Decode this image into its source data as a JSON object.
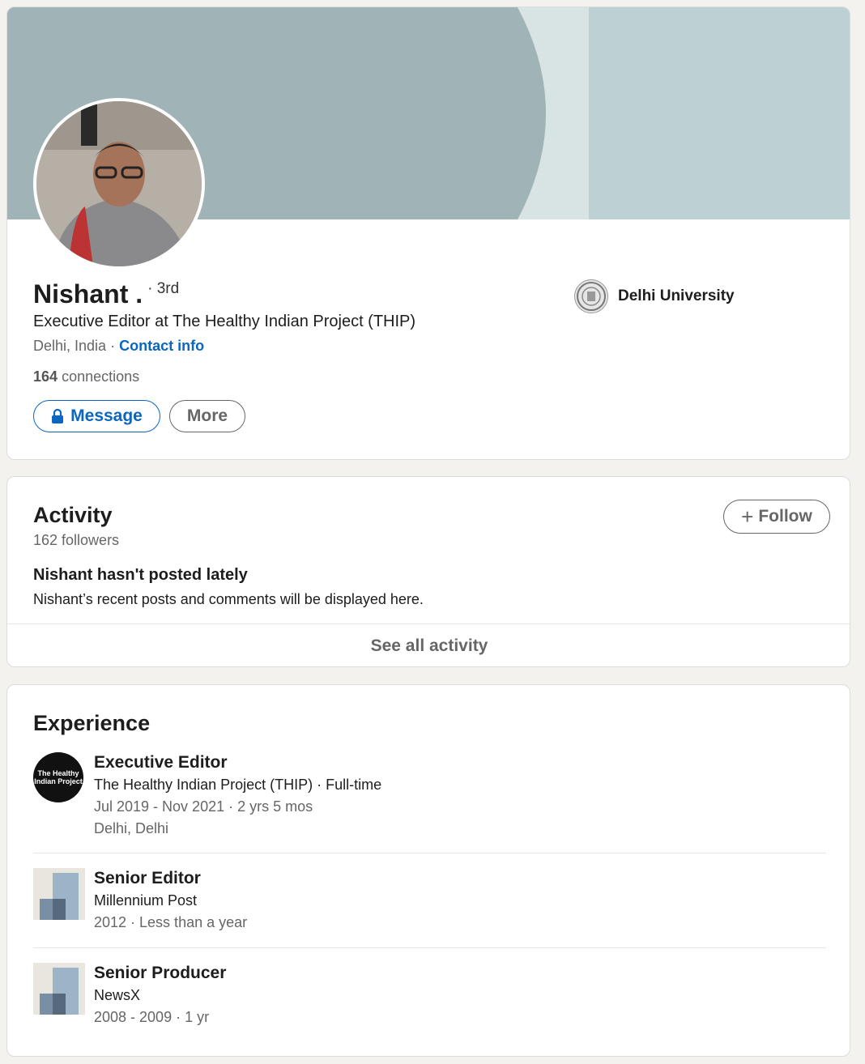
{
  "profile": {
    "name": "Nishant .",
    "degree": "· 3rd",
    "headline": "Executive Editor at The Healthy Indian Project (THIP)",
    "location": "Delhi, India",
    "separator": "·",
    "contact_label": "Contact info",
    "connections_count": "164",
    "connections_label": "connections",
    "message_label": "Message",
    "more_label": "More",
    "education": "Delhi University"
  },
  "activity": {
    "title": "Activity",
    "followers": "162 followers",
    "follow_label": "Follow",
    "empty_title": "Nishant hasn't posted lately",
    "empty_subtitle": "Nishant’s recent posts and comments will be displayed here.",
    "see_all_label": "See all activity"
  },
  "experience": {
    "title": "Experience",
    "items": [
      {
        "title": "Executive Editor",
        "company": "The Healthy Indian Project (THIP) · Full-time",
        "dates": "Jul 2019 - Nov 2021 · 2 yrs 5 mos",
        "location": "Delhi, Delhi",
        "logo_text": "The Healthy Indian Project"
      },
      {
        "title": "Senior Editor",
        "company": "Millennium Post",
        "dates": "2012 · Less than a year"
      },
      {
        "title": "Senior Producer",
        "company": "NewsX",
        "dates": "2008 - 2009 · 1 yr"
      }
    ]
  },
  "colors": {
    "link_blue": "#0a66c2",
    "banner_dark": "#a0b3b6",
    "banner_light": "#bdd1d4",
    "banner_stripe": "#d8e3e4"
  }
}
